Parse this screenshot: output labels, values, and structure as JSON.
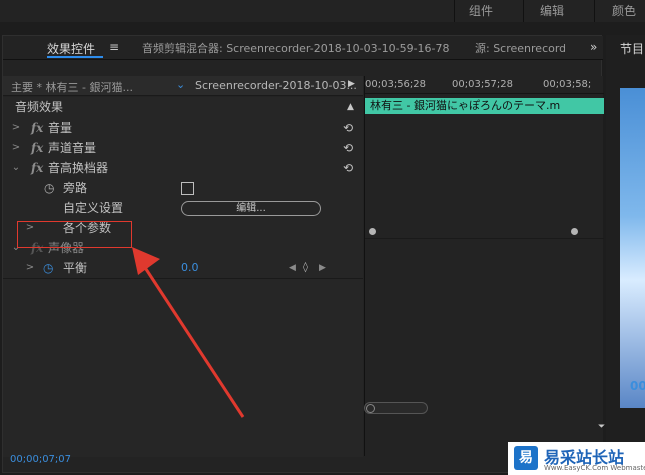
{
  "workspace": {
    "tabs": [
      "组件",
      "编辑",
      "颜色"
    ]
  },
  "panel": {
    "tabs": [
      {
        "label": "效果控件"
      },
      {
        "label": "音频剪辑混合器: Screenrecorder-2018-10-03-10-59-16-78"
      },
      {
        "label": "源: Screenrecorde"
      }
    ],
    "menu_icon": "≡",
    "overflow_icon": "»"
  },
  "clip_row": {
    "master": "主要 * 林有三 - 銀河猫...",
    "clip": "Screenrecorder-2018-10-03..."
  },
  "section_title": "音频效果",
  "effects": [
    {
      "label": "音量",
      "fx": "fx"
    },
    {
      "label": "声道音量",
      "fx": "fx"
    },
    {
      "label": "音高换档器",
      "fx": "fx"
    }
  ],
  "params": {
    "bypass": "旁路",
    "custom_setup": "自定义设置",
    "edit_button": "编辑...",
    "individual_params": "各个参数",
    "panner": "声像器",
    "balance": "平衡",
    "balance_value": "0.0"
  },
  "timeline": {
    "timecodes": [
      "00;03;56;28",
      "00;03;57;28",
      "00;03;58;"
    ],
    "clip_label": "林有三 - 銀河猫にゃぽろんのテーマ.m"
  },
  "bottom_timecode": "00;00;07;07",
  "program": {
    "tab": "节目",
    "timecode": "00"
  },
  "watermark": {
    "logo": "易",
    "text": "易采站长站",
    "url": "Www.EasyCK.Com Webmaster"
  },
  "colors": {
    "accent": "#3b8edd",
    "clip": "#41c7a5",
    "highlight": "#e0392e"
  }
}
